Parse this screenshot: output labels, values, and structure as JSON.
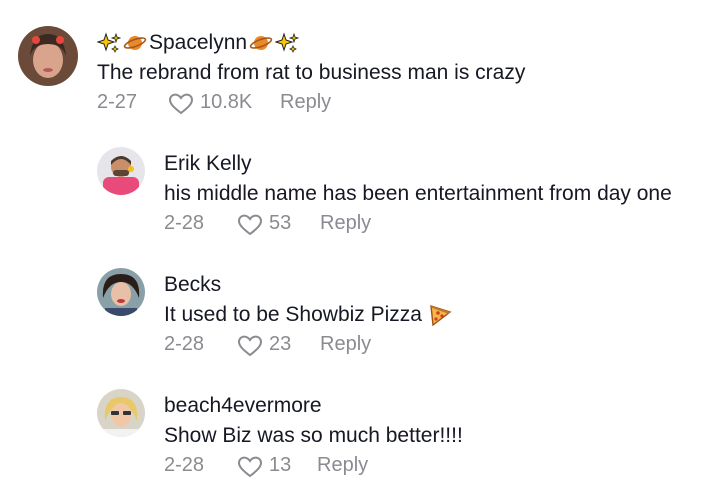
{
  "comments": [
    {
      "username": "Spacelynn",
      "username_prefix_icons": [
        "sparkles-icon",
        "ringed-planet-icon"
      ],
      "username_suffix_icons": [
        "ringed-planet-icon",
        "sparkles-icon"
      ],
      "text": "The rebrand from rat to business man is crazy",
      "date": "2-27",
      "likes": "10.8K",
      "reply_label": "Reply"
    },
    {
      "username": "Erik Kelly",
      "text": "his middle name has been entertainment from day one",
      "date": "2-28",
      "likes": "53",
      "reply_label": "Reply"
    },
    {
      "username": "Becks",
      "text": "It used to be Showbiz Pizza",
      "text_suffix_icon": "pizza-icon",
      "date": "2-28",
      "likes": "23",
      "reply_label": "Reply"
    },
    {
      "username": "beach4evermore",
      "text": "Show Biz was so much better!!!!",
      "date": "2-28",
      "likes": "13",
      "reply_label": "Reply"
    }
  ],
  "colors": {
    "text": "#161823",
    "meta": "#8a8b91",
    "background": "#ffffff"
  }
}
